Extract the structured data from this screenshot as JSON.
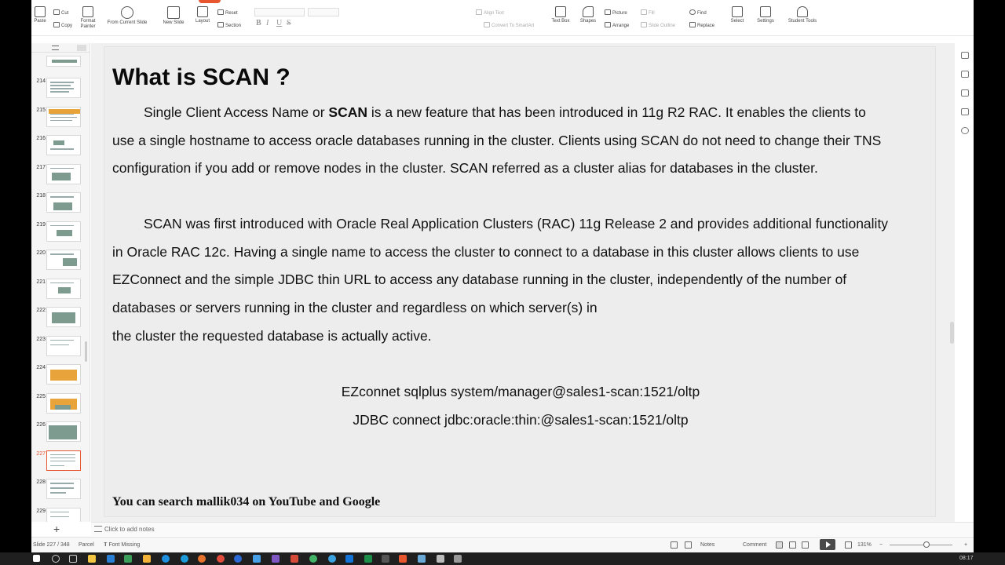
{
  "ribbon": {
    "paste": "Paste",
    "cut": "Cut",
    "copy": "Copy",
    "format_painter": "Format Painter",
    "from_current_slide": "From Current Slide",
    "new_slide": "New Slide",
    "layout": "Layout",
    "reset": "Reset",
    "section": "Section",
    "align_text": "Align Text",
    "convert_smartart": "Convert To SmartArt",
    "text_box": "Text Box",
    "shapes": "Shapes",
    "picture": "Picture",
    "arrange": "Arrange",
    "fill": "Fill",
    "slide_outline": "Slide Outline",
    "find": "Find",
    "replace": "Replace",
    "select": "Select",
    "settings": "Settings",
    "student_tools": "Student Tools",
    "format_buttons": [
      "B",
      "I",
      "U",
      "S"
    ]
  },
  "thumbnails": [
    {
      "num": "214",
      "active": false
    },
    {
      "num": "215",
      "active": false
    },
    {
      "num": "216",
      "active": false
    },
    {
      "num": "217",
      "active": false
    },
    {
      "num": "218",
      "active": false
    },
    {
      "num": "219",
      "active": false
    },
    {
      "num": "220",
      "active": false
    },
    {
      "num": "221",
      "active": false
    },
    {
      "num": "222",
      "active": false
    },
    {
      "num": "223",
      "active": false
    },
    {
      "num": "224",
      "active": false
    },
    {
      "num": "225",
      "active": false
    },
    {
      "num": "226",
      "active": false
    },
    {
      "num": "227",
      "active": true
    },
    {
      "num": "228",
      "active": false
    },
    {
      "num": "229",
      "active": false
    }
  ],
  "slide": {
    "title": "What is SCAN ?",
    "para1": {
      "l1_a": "Single Client Access Name or ",
      "l1_b": "SCAN",
      "l1_c": "  is a new feature that has been introduced in 11g R2 RAC. It enables the clients to",
      "l2": "use a single hostname to access oracle databases running in the cluster. Clients using SCAN do not need to change their TNS",
      "l3": "configuration if you add or remove nodes in the cluster.  SCAN referred as a cluster alias for databases in the cluster."
    },
    "para2": {
      "l1": "SCAN was first introduced with Oracle Real Application Clusters (RAC) 11g Release 2 and provides additional functionality",
      "l2": "in Oracle RAC 12c. Having a single name to access the cluster to connect to a database in this cluster allows clients to use",
      "l3": "EZConnect and the simple JDBC thin URL to access any database running in the cluster, independently of the number of",
      "l4": "databases or servers running in the cluster and regardless on which server(s) in",
      "l5": "the cluster the requested database is actually active."
    },
    "ezconnect": "EZconnet sqlplus system/manager@sales1-scan:1521/oltp",
    "jdbc": "JDBC connect jdbc:oracle:thin:@sales1-scan:1521/oltp",
    "footer": "You can search mallik034 on YouTube and Google"
  },
  "notes": {
    "placeholder": "Click to add notes"
  },
  "status": {
    "slide_counter": "Slide 227 / 348",
    "theme": "Parcel",
    "font_missing": "Font Missing",
    "notes": "Notes",
    "comment": "Comment",
    "zoom": "131%"
  },
  "taskbar": {
    "clock": "08:17"
  },
  "colors": {
    "accent": "#e8562f"
  }
}
